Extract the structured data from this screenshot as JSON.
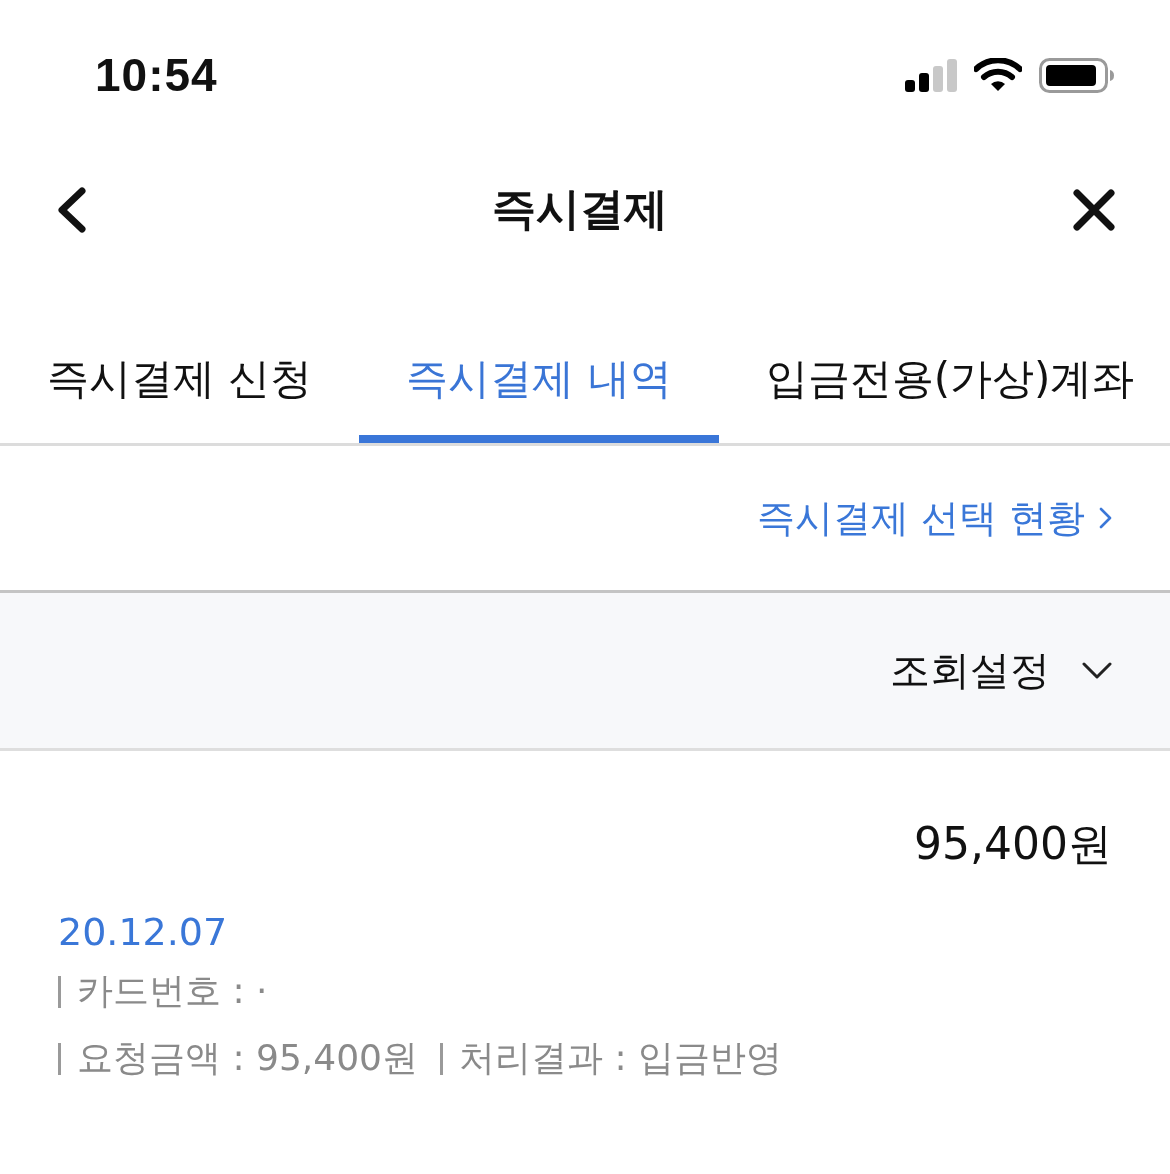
{
  "status_bar": {
    "time": "10:54"
  },
  "nav": {
    "title": "즉시결제"
  },
  "tabs": [
    {
      "label": "즉시결제 신청",
      "selected": false
    },
    {
      "label": "즉시결제 내역",
      "selected": true
    },
    {
      "label": "입금전용(가상)계좌",
      "selected": false
    }
  ],
  "status_link": {
    "label": "즉시결제 선택 현황"
  },
  "filter": {
    "label": "조회설정",
    "expanded": false
  },
  "records": [
    {
      "amount": "95,400원",
      "date": "20.12.07",
      "detail_lines": [
        {
          "items": [
            "카드번호 : ·"
          ]
        },
        {
          "items": [
            "요청금액 : 95,400원",
            "처리결과 : 입금반영"
          ]
        }
      ]
    }
  ]
}
